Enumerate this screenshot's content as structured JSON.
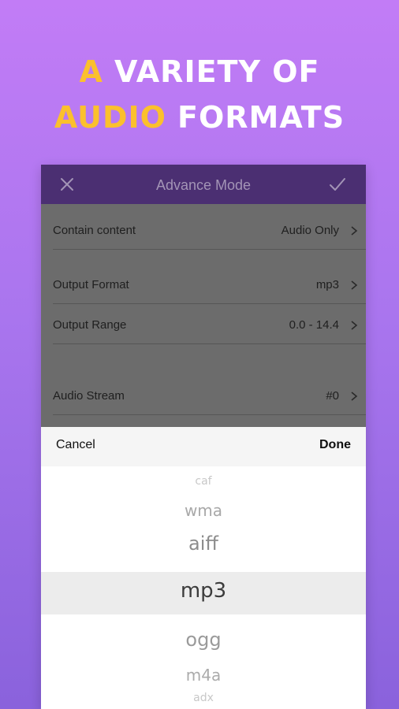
{
  "headline": {
    "line1_accent": "A",
    "line1_rest": "VARIETY  OF",
    "line2_accent": "AUDIO",
    "line2_rest": "FORMATS"
  },
  "appbar": {
    "title": "Advance Mode",
    "left_icon": "close-icon",
    "right_icon": "check-icon"
  },
  "settings": [
    {
      "label": "Contain content",
      "value": "Audio Only"
    },
    {
      "label": "Output Format",
      "value": "mp3"
    },
    {
      "label": "Output Range",
      "value": "0.0 - 14.4"
    },
    {
      "label": "Audio Stream",
      "value": "#0"
    }
  ],
  "picker": {
    "cancel_label": "Cancel",
    "done_label": "Done",
    "selected": "mp3",
    "options": [
      "caf",
      "wma",
      "aiff",
      "mp3",
      "ogg",
      "m4a",
      "adx"
    ]
  },
  "colors": {
    "accent": "#fbc02d",
    "appbar": "#4b2f72",
    "background_top": "#c27cf6",
    "background_bottom": "#8a62dc"
  }
}
